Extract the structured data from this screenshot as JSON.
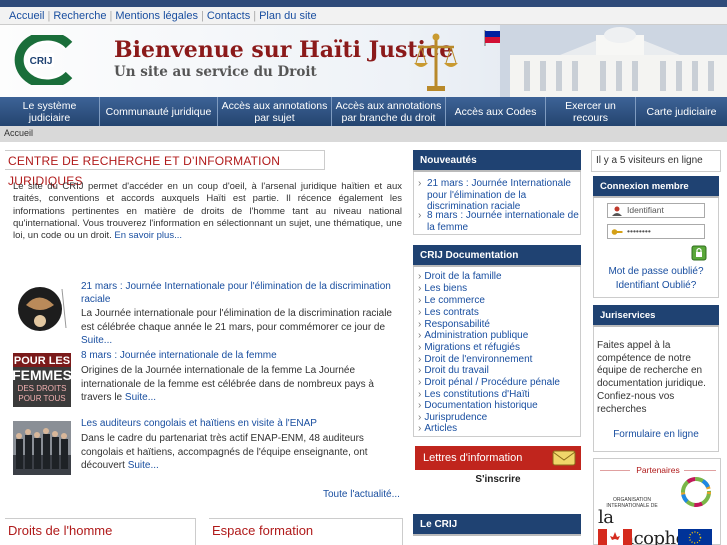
{
  "top_links": [
    "Accueil",
    "Recherche",
    "Mentions légales",
    "Contacts",
    "Plan du site"
  ],
  "header": {
    "title": "Bienvenue sur Haïti Justice",
    "subtitle": "Un site au service du Droit",
    "logo_text": "CRIJ"
  },
  "nav": [
    "Le système judiciaire",
    "Communauté juridique",
    "Accès aux annotations par sujet",
    "Accès aux annotations par branche du droit",
    "Accès aux Codes",
    "Exercer un recours",
    "Carte judiciaire"
  ],
  "breadcrumb": "Accueil",
  "main": {
    "title": "CENTRE DE RECHERCHE ET D’INFORMATION JURIDIQUES",
    "intro": "Le site du CRIJ permet d'accéder en un coup d'oeil, à l'arsenal juridique haïtien et aux traités, conventions et accords auxquels Haïti est partie. Il récence également les informations pertinentes en matière de droits de l'homme tant au niveau national qu'international. Vous trouverez l'information en sélectionnant un sujet, une thématique, une loi, un code ou un droit.",
    "intro_more": "En savoir plus...",
    "news": [
      {
        "title": "21 mars : Journée Internationale pour l'élimination de la discrimination raciale",
        "text": "La Journée internationale pour l'élimination de la discrimination raciale est célébrée chaque année le 21 mars, pour commémorer ce jour de",
        "more": "Suite..."
      },
      {
        "title": "8 mars : Journée internationale de la femme",
        "text": "Origines de la Journée internationale de la femme La Journée internationale de la femme est célébrée dans de nombreux pays à travers le",
        "more": "Suite...",
        "thumb_words": [
          "POUR LES",
          "FEMMES",
          "DES DROITS",
          "POUR TOUS"
        ]
      },
      {
        "title": "Les auditeurs congolais et haïtiens en visite à l'ENAP",
        "text": "Dans le cadre du partenariat très actif ENAP-ENM, 48 auditeurs congolais et haïtiens, accompagnés de l'équipe enseignante, ont découvert",
        "more": "Suite..."
      }
    ],
    "all_news": "Toute l'actualité..."
  },
  "bottom": {
    "left": "Droits de l'homme",
    "right": "Espace formation"
  },
  "nouveautes": {
    "header": "Nouveautés",
    "items": [
      "21 mars : Journée Internationale pour l'élimination de la discrimination raciale",
      "8 mars : Journée internationale de la femme"
    ]
  },
  "documentation": {
    "header": "CRIJ Documentation",
    "items": [
      "Droit de la famille",
      "Les biens",
      "Le commerce",
      "Les contrats",
      "Responsabilité",
      "Administration publique",
      "Migrations et réfugiés",
      "Droit de l'environnement",
      "Droit du travail",
      "Droit pénal / Procédure pénale",
      "Les constitutions d'Haïti",
      "Documentation historique",
      "Jurisprudence",
      "Articles"
    ]
  },
  "newsletter": {
    "label": "Lettres d'information",
    "subscribe": "S'inscrire"
  },
  "crij_header": "Le CRIJ",
  "visitors": "Il y a 5 visiteurs en ligne",
  "login": {
    "header": "Connexion membre",
    "username_placeholder": "Identifiant",
    "password_mask": "••••••••",
    "forgot_password": "Mot de passe oublié?",
    "forgot_username": "Identifiant Oublié?"
  },
  "juriservices": {
    "header": "Juriservices",
    "text": "Faites appel à la compétence de notre équipe de recherche en documentation juridique. Confiez-nous vos recherches",
    "link": "Formulaire en ligne"
  },
  "partners": {
    "label": "Partenaires",
    "francophonie_org": "ORGANISATION INTERNATIONALE DE",
    "francophonie": "la francophonie"
  },
  "colors": {
    "nav_bg": "#2d4f7f",
    "panel_header": "#1f4272",
    "accent_red": "#b01a1a",
    "link": "#1a4fa0"
  }
}
